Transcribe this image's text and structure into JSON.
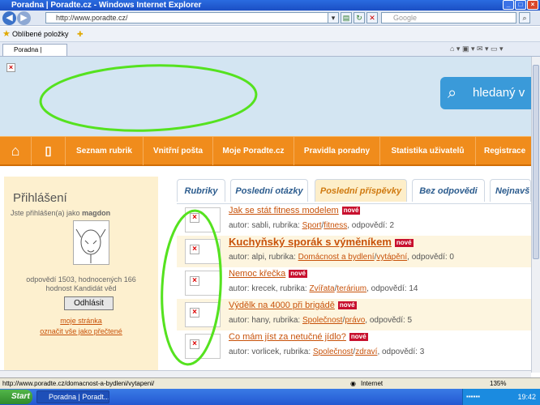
{
  "window": {
    "title": "Poradna | Poradte.cz - Windows Internet Explorer"
  },
  "browser": {
    "address": "http://www.poradte.cz/",
    "search_placeholder": "Google",
    "favorites_label": "Oblíbené položky",
    "tab_label": "Poradna | Poradte.cz"
  },
  "site": {
    "search_button": "hledaný v",
    "menu": [
      "Seznam rubrik",
      "Vnitřní pošta",
      "Moje Poradte.cz",
      "Pravidla poradny",
      "Statistika uživatelů",
      "Registrace"
    ],
    "login": {
      "title": "Přihlášení",
      "status_prefix": "Jste přihlášen(a) jako",
      "username": "magdon",
      "stats_line1": "odpovědí 1503, hodnocených 166",
      "stats_line2": "hodnost Kandidát věd",
      "logout_button": "Odhlásit",
      "my_page_link": "moje stránka",
      "mark_read_link": "označit vše jako přečtené"
    },
    "tabs": [
      "Rubriky",
      "Poslední otázky",
      "Poslední příspěvky",
      "Bez odpovědi",
      "Nejnavš"
    ],
    "active_tab": 2,
    "posts": [
      {
        "title": "Jak se stát fitness modelem",
        "badge": "nové",
        "author": "autor: sabli, rubrika:",
        "category": "Sport",
        "subcategory": "fitness",
        "answers": ", odpovědí: 2"
      },
      {
        "title": "Kuchyňský sporák s výměníkem",
        "badge": "nové",
        "author": "autor: alpi, rubrika:",
        "category": "Domácnost a bydlení",
        "subcategory": "vytápění",
        "answers": ", odpovědí: 0"
      },
      {
        "title": "Nemoc křečka",
        "badge": "nové",
        "author": "autor: krecek, rubrika:",
        "category": "Zvířata",
        "subcategory": "terárium",
        "answers": ", odpovědí: 14"
      },
      {
        "title": "Výdělk na 4000 při brigádě",
        "badge": "nové",
        "author": "autor: hany, rubrika:",
        "category": "Společnost",
        "subcategory": "právo",
        "answers": ", odpovědí: 5"
      },
      {
        "title": "Co mám jíst za netučné jídlo?",
        "badge": "nové",
        "author": "autor: vorlicek, rubrika:",
        "category": "Společnost",
        "subcategory": "zdraví",
        "answers": ", odpovědí: 3"
      }
    ]
  },
  "statusbar": {
    "url": "http://www.poradte.cz/domacnost-a-bydleni/vytapeni/",
    "zone": "Internet",
    "zoom": "135%"
  },
  "taskbar": {
    "start": "Start",
    "window_button": "Poradna | Poradt...",
    "clock": "19:42"
  },
  "colors": {
    "accent_orange": "#f08c1c",
    "annotation_green": "#55e21f",
    "link": "#c8520a"
  }
}
